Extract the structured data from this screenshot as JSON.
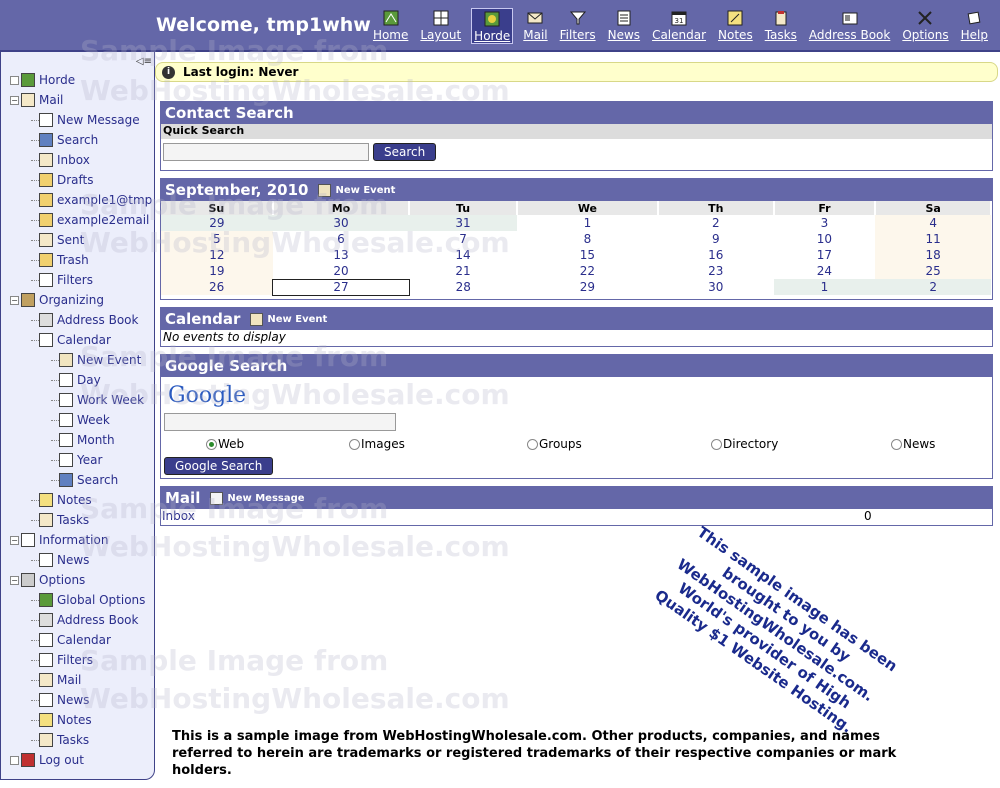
{
  "header": {
    "welcome": "Welcome, tmp1whw",
    "nav": [
      {
        "label": "Home",
        "icon": "home-icon",
        "active": false
      },
      {
        "label": "Layout",
        "icon": "layout-icon",
        "active": false
      },
      {
        "label": "Horde",
        "icon": "horde-icon",
        "active": true
      },
      {
        "label": "Mail",
        "icon": "mail-icon",
        "active": false
      },
      {
        "label": "Filters",
        "icon": "filter-icon",
        "active": false
      },
      {
        "label": "News",
        "icon": "news-icon",
        "active": false
      },
      {
        "label": "Calendar",
        "icon": "calendar-icon",
        "active": false
      },
      {
        "label": "Notes",
        "icon": "notes-icon",
        "active": false
      },
      {
        "label": "Tasks",
        "icon": "tasks-icon",
        "active": false
      },
      {
        "label": "Address Book",
        "icon": "address-book-icon",
        "active": false
      },
      {
        "label": "Options",
        "icon": "options-icon",
        "active": false
      },
      {
        "label": "Help",
        "icon": "help-icon",
        "active": false
      }
    ]
  },
  "sidebar": {
    "items": [
      {
        "label": "Horde",
        "level": 0,
        "icon": "horde-icon"
      },
      {
        "label": "Mail",
        "level": 0,
        "icon": "mail-icon"
      },
      {
        "label": "New Message",
        "level": 1,
        "icon": "compose-icon"
      },
      {
        "label": "Search",
        "level": 1,
        "icon": "search-icon"
      },
      {
        "label": "Inbox",
        "level": 1,
        "icon": "inbox-icon"
      },
      {
        "label": "Drafts",
        "level": 1,
        "icon": "folder-icon"
      },
      {
        "label": "example1@tmp",
        "level": 1,
        "icon": "folder-icon"
      },
      {
        "label": "example2email",
        "level": 1,
        "icon": "folder-icon"
      },
      {
        "label": "Sent",
        "level": 1,
        "icon": "sent-icon"
      },
      {
        "label": "Trash",
        "level": 1,
        "icon": "folder-icon"
      },
      {
        "label": "Filters",
        "level": 1,
        "icon": "filter-icon"
      },
      {
        "label": "Organizing",
        "level": 0,
        "icon": "organizing-icon"
      },
      {
        "label": "Address Book",
        "level": 1,
        "icon": "address-book-icon"
      },
      {
        "label": "Calendar",
        "level": 1,
        "icon": "calendar-icon"
      },
      {
        "label": "New Event",
        "level": 2,
        "icon": "new-event-icon"
      },
      {
        "label": "Day",
        "level": 2,
        "icon": "day-icon"
      },
      {
        "label": "Work Week",
        "level": 2,
        "icon": "work-week-icon"
      },
      {
        "label": "Week",
        "level": 2,
        "icon": "week-icon"
      },
      {
        "label": "Month",
        "level": 2,
        "icon": "month-icon"
      },
      {
        "label": "Year",
        "level": 2,
        "icon": "year-icon"
      },
      {
        "label": "Search",
        "level": 2,
        "icon": "search-icon"
      },
      {
        "label": "Notes",
        "level": 1,
        "icon": "notes-icon"
      },
      {
        "label": "Tasks",
        "level": 1,
        "icon": "tasks-icon"
      },
      {
        "label": "Information",
        "level": 0,
        "icon": "information-icon"
      },
      {
        "label": "News",
        "level": 1,
        "icon": "news-icon"
      },
      {
        "label": "Options",
        "level": 0,
        "icon": "options-icon"
      },
      {
        "label": "Global Options",
        "level": 1,
        "icon": "horde-icon"
      },
      {
        "label": "Address Book",
        "level": 1,
        "icon": "address-book-icon"
      },
      {
        "label": "Calendar",
        "level": 1,
        "icon": "calendar-icon"
      },
      {
        "label": "Filters",
        "level": 1,
        "icon": "filter-icon"
      },
      {
        "label": "Mail",
        "level": 1,
        "icon": "mail-icon"
      },
      {
        "label": "News",
        "level": 1,
        "icon": "news-icon"
      },
      {
        "label": "Notes",
        "level": 1,
        "icon": "notes-icon"
      },
      {
        "label": "Tasks",
        "level": 1,
        "icon": "tasks-icon"
      },
      {
        "label": "Log out",
        "level": 0,
        "icon": "logout-icon"
      }
    ]
  },
  "last_login": "Last login: Never",
  "contact_search": {
    "title": "Contact Search",
    "subtitle": "Quick Search",
    "button": "Search",
    "value": ""
  },
  "month_calendar": {
    "title": "September, 2010",
    "new_event": "New Event",
    "days": [
      "Su",
      "Mo",
      "Tu",
      "We",
      "Th",
      "Fr",
      "Sa"
    ],
    "weeks": [
      [
        "29",
        "30",
        "31",
        "1",
        "2",
        "3",
        "4"
      ],
      [
        "5",
        "6",
        "7",
        "8",
        "9",
        "10",
        "11"
      ],
      [
        "12",
        "13",
        "14",
        "15",
        "16",
        "17",
        "18"
      ],
      [
        "19",
        "20",
        "21",
        "22",
        "23",
        "24",
        "25"
      ],
      [
        "26",
        "27",
        "28",
        "29",
        "30",
        "1",
        "2"
      ]
    ],
    "today": "27"
  },
  "calendar": {
    "title": "Calendar",
    "new_event": "New Event",
    "empty": "No events to display"
  },
  "google": {
    "title": "Google Search",
    "logo": "Google",
    "options": [
      "Web",
      "Images",
      "Groups",
      "Directory",
      "News"
    ],
    "selected": "Web",
    "button": "Google Search"
  },
  "mail": {
    "title": "Mail",
    "new_message": "New Message",
    "folder": "Inbox",
    "count": "0"
  },
  "watermark": [
    "Sample Image from",
    "WebHostingWholesale.com"
  ],
  "promo": "This sample image has been brought to you by WebHostingWholesale.com. World's provider of High Quality $1 Website Hosting.",
  "disclaimer": "This is a sample image from WebHostingWholesale.com.  Other products, companies, and names referred to herein are trademarks or registered trademarks of their respective companies or mark holders."
}
